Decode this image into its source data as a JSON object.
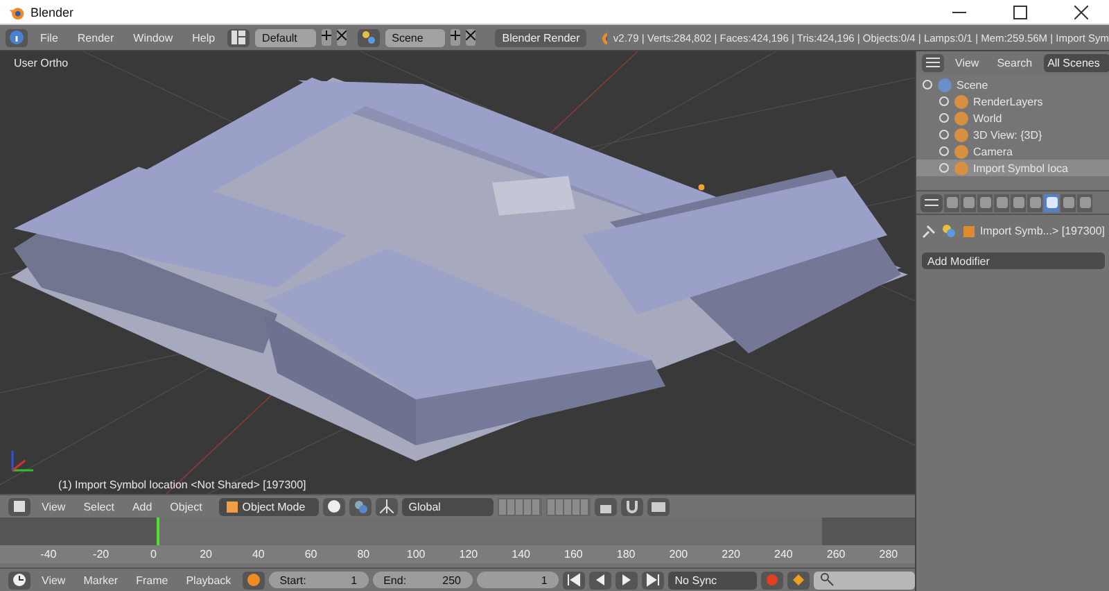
{
  "window": {
    "title": "Blender"
  },
  "info_header": {
    "menus": [
      "File",
      "Render",
      "Window",
      "Help"
    ],
    "layout": "Default",
    "scene": "Scene",
    "engine": "Blender Render",
    "stats": "v2.79 | Verts:284,802 | Faces:424,196 | Tris:424,196 | Objects:0/4 | Lamps:0/1 | Mem:259.56M | Import Sym"
  },
  "viewport": {
    "view_label": "User Ortho",
    "object_info": "(1) Import Symbol location <Not Shared> [197300]"
  },
  "outliner": {
    "menus": [
      "View",
      "Search"
    ],
    "filter": "All Scenes",
    "tree": [
      {
        "label": "Scene",
        "selected": false,
        "children": [
          {
            "label": "RenderLayers",
            "selected": false
          },
          {
            "label": "World",
            "selected": false
          },
          {
            "label": "3D View: {3D}",
            "selected": false
          },
          {
            "label": "Camera",
            "selected": false
          },
          {
            "label": "Import Symbol loca",
            "selected": true
          }
        ]
      }
    ]
  },
  "properties": {
    "tabs": [
      {
        "selected": false
      },
      {
        "selected": false
      },
      {
        "selected": false
      },
      {
        "selected": false
      },
      {
        "selected": false
      },
      {
        "selected": false
      },
      {
        "selected": true
      },
      {
        "selected": false
      },
      {
        "selected": false
      }
    ],
    "breadcrumb": "Import Symb...> [197300]",
    "add_modifier": "Add Modifier"
  },
  "view3d_header": {
    "menus": [
      "View",
      "Select",
      "Add",
      "Object"
    ],
    "mode": "Object Mode",
    "orientation": "Global"
  },
  "timeline": {
    "ticks": [
      "-40",
      "-20",
      "0",
      "20",
      "40",
      "60",
      "80",
      "100",
      "120",
      "140",
      "160",
      "180",
      "200",
      "220",
      "240",
      "260",
      "280"
    ]
  },
  "timeline_header": {
    "menus": [
      "View",
      "Marker",
      "Frame",
      "Playback"
    ],
    "start_label": "Start:",
    "start": "1",
    "end_label": "End:",
    "end": "250",
    "current": "1",
    "sync": "No Sync"
  }
}
